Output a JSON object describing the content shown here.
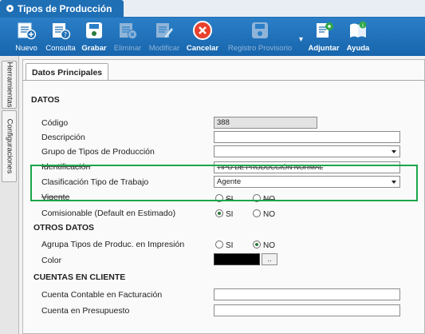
{
  "window": {
    "title": "Tipos de Producción"
  },
  "toolbar": {
    "nuevo": "Nuevo",
    "consulta": "Consulta",
    "grabar": "Grabar",
    "eliminar": "Eliminar",
    "modificar": "Modificar",
    "cancelar": "Cancelar",
    "registro": "Registro Provisorio",
    "adjuntar": "Adjuntar",
    "ayuda": "Ayuda"
  },
  "sidetabs": {
    "herramientas": "Herramientas",
    "configuraciones": "Configuraciones"
  },
  "panel": {
    "tab": "Datos Principales"
  },
  "sections": {
    "datos": "DATOS",
    "otros": "OTROS DATOS",
    "cuentas": "CUENTAS EN CLIENTE"
  },
  "fields": {
    "codigo": {
      "label": "Código",
      "value": "388"
    },
    "descripcion": {
      "label": "Descripción",
      "value": ""
    },
    "grupo": {
      "label": "Grupo de Tipos de Producción",
      "value": ""
    },
    "identificacion": {
      "label": "Identificación",
      "value": "TIPO DE PRODUCCIÓN NORMAL"
    },
    "clasificacion": {
      "label": "Clasificación Tipo de Trabajo",
      "value": "Agente"
    },
    "vigente": {
      "label": "Vigente",
      "yes": "SI",
      "no": "NO"
    },
    "comisionable": {
      "label": "Comisionable (Default en Estimado)",
      "yes": "SI",
      "no": "NO"
    },
    "agrupa": {
      "label": "Agrupa Tipos de Produc. en Impresión",
      "yes": "SI",
      "no": "NO"
    },
    "color": {
      "label": "Color",
      "button": "..",
      "value": "#000000"
    },
    "cuenta_contable": {
      "label": "Cuenta Contable en Facturación",
      "value": ""
    },
    "cuenta_presupuesto": {
      "label": "Cuenta en Presupuesto",
      "value": ""
    }
  },
  "colors": {
    "accent": "#1f6fb5",
    "highlight": "#1aa64a"
  }
}
